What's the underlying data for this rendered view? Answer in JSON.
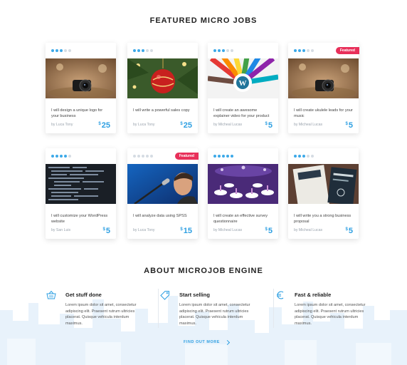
{
  "featured_title": "FEATURED MICRO JOBS",
  "about_title": "ABOUT MICROJOB ENGINE",
  "colors": {
    "accent": "#2d9fe2",
    "badge": "#e8305a",
    "star_on": "#3da9e8",
    "star_off": "#d5dce3"
  },
  "jobs": [
    {
      "title": "I will design a unique logo for your business",
      "author": "by Luca Tony",
      "currency": "$",
      "price": "25",
      "stars": 3,
      "featured": false,
      "badge": "",
      "image": "camera"
    },
    {
      "title": "I will write a powerful sales copy",
      "author": "by Luca Tony",
      "currency": "$",
      "price": "25",
      "stars": 3,
      "featured": false,
      "badge": "",
      "image": "ornament"
    },
    {
      "title": "I will create an awesome explainer video for your product",
      "author": "by Micheal Lucas",
      "currency": "$",
      "price": "5",
      "stars": 3,
      "featured": false,
      "badge": "",
      "image": "pencils"
    },
    {
      "title": "I will create ukulele leads for your music",
      "author": "by Micheal Lucas",
      "currency": "$",
      "price": "5",
      "stars": 3,
      "featured": true,
      "badge": "Featured",
      "image": "camera"
    },
    {
      "title": "I will customize your WordPress website",
      "author": "by San Luis",
      "currency": "$",
      "price": "5",
      "stars": 4,
      "featured": false,
      "badge": "",
      "image": "code"
    },
    {
      "title": "I will analyze data using SPSS",
      "author": "by Luca Tony",
      "currency": "$",
      "price": "15",
      "stars": 0,
      "featured": true,
      "badge": "Featured",
      "image": "singer"
    },
    {
      "title": "I will create an effective survey questionnaire",
      "author": "by Micheal Lucas",
      "currency": "$",
      "price": "5",
      "stars": 5,
      "featured": false,
      "badge": "",
      "image": "hall"
    },
    {
      "title": "I will write you a strong business proposal",
      "author": "by Micheal Lucas",
      "currency": "$",
      "price": "5",
      "stars": 3,
      "featured": false,
      "badge": "",
      "image": "cards"
    }
  ],
  "features": [
    {
      "heading": "Get stuff done",
      "body": "Lorem ipsum dolor sit amet, consectetur adipiscing elit. Praesent rutrum ultricies placerat. Quisque vehicula interdum maximus.",
      "icon": "basket-icon"
    },
    {
      "heading": "Start selling",
      "body": "Lorem ipsum dolor sit amet, consectetur adipiscing elit. Praesent rutrum ultricies placerat. Quisque vehicula interdum maximus.",
      "icon": "tag-icon"
    },
    {
      "heading": "Fast & reliable",
      "body": "Lorem ipsum dolor sit amet, consectetur adipiscing elit. Praesent rutrum ultricies placerat. Quisque vehicula interdum maximus.",
      "icon": "euro-icon"
    }
  ],
  "find_out_more": "FIND OUT MORE"
}
